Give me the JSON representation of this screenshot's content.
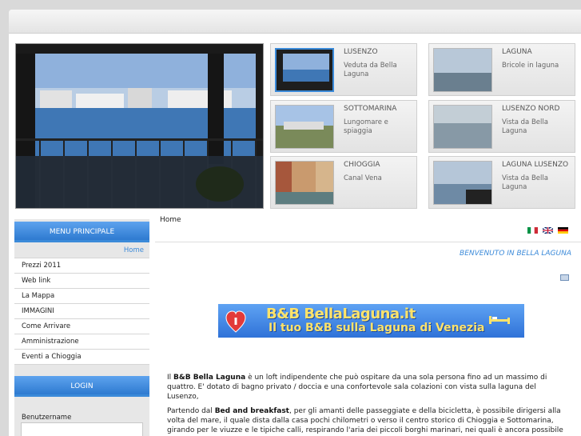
{
  "thumbnails": [
    {
      "title": "LUSENZO",
      "desc": "Veduta da Bella Laguna",
      "active": true
    },
    {
      "title": "LAGUNA",
      "desc": "Bricole in laguna",
      "active": false
    },
    {
      "title": "SOTTOMARINA",
      "desc": "Lungomare e spiaggia",
      "active": false
    },
    {
      "title": "LUSENZO NORD",
      "desc": "Vista da Bella Laguna",
      "active": false
    },
    {
      "title": "CHIOGGIA",
      "desc": "Canal Vena",
      "active": false
    },
    {
      "title": "LAGUNA LUSENZO",
      "desc": "Vista da Bella Laguna",
      "active": false
    }
  ],
  "sidebar": {
    "menu_title": "MENU PRINCIPALE",
    "items": [
      {
        "label": "Home"
      },
      {
        "label": "Prezzi 2011"
      },
      {
        "label": "Web link"
      },
      {
        "label": "La Mappa"
      },
      {
        "label": "IMMAGINI"
      },
      {
        "label": "Come Arrivare"
      },
      {
        "label": "Amministrazione"
      },
      {
        "label": "Eventi a Chioggia"
      }
    ],
    "login_title": "LOGIN",
    "username_label": "Benutzername",
    "username_value": ""
  },
  "content": {
    "breadcrumb": "Home",
    "welcome": "BENVENUTO IN BELLA LAGUNA",
    "banner_line1": "B&B BellaLaguna.it",
    "banner_line2": "Il tuo B&B sulla Laguna di Venezia",
    "para1_intro": "Il ",
    "para1_bold": "B&B Bella Laguna",
    "para1_rest": " è un loft indipendente che può ospitare da una sola persona fino ad un massimo di quattro. E' dotato di bagno privato / doccia e una confortevole sala colazioni con vista sulla laguna del Lusenzo,",
    "para2_intro": "Partendo dal ",
    "para2_bold": "Bed and breakfast",
    "para2_rest": ", per gli amanti delle passeggiate e della bicicletta, è possibile dirigersi alla volta del mare, il quale dista dalla casa pochi chilometri o verso il centro storico di Chioggia e Sottomarina, girando per le viuzze e le tipiche calli, respirando l'aria dei piccoli borghi marinari, nei quali è ancora possibile vedere gli artigiani del settore alle prese con nasse e reti, oppure vedere i pescatori al rientro con ceste di freschissimo pesce."
  },
  "colors": {
    "accent": "#3b8ad9",
    "menu_gradient_top": "#5da3ee",
    "menu_gradient_bottom": "#2e7ad0",
    "banner_text": "#ffe36a"
  },
  "flags": [
    "italian-flag-icon",
    "uk-flag-icon",
    "german-flag-icon"
  ]
}
